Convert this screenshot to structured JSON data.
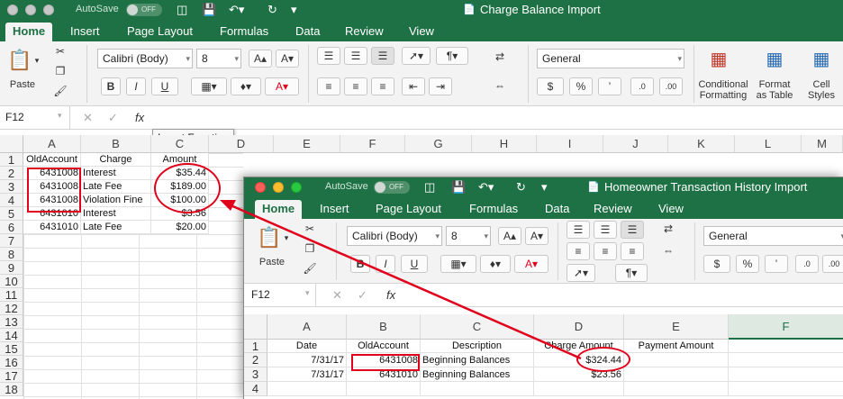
{
  "colors": {
    "excel_green": "#1e7145",
    "annotation_red": "#e0001b"
  },
  "window1": {
    "title": "Charge Balance Import",
    "autosave_label": "AutoSave",
    "autosave_state": "OFF",
    "tabs": [
      "Home",
      "Insert",
      "Page Layout",
      "Formulas",
      "Data",
      "Review",
      "View"
    ],
    "ribbon": {
      "paste_label": "Paste",
      "font_name": "Calibri (Body)",
      "font_size": "8",
      "grow_font": "A▴",
      "shrink_font": "A▾",
      "bold": "B",
      "italic": "I",
      "underline": "U",
      "number_format": "General",
      "currency": "$",
      "percent": "%",
      "comma": "’",
      "conditional_formatting": "Conditional Formatting",
      "format_as_table": "Format as Table",
      "cell_styles": "Cell Styles"
    },
    "formula_bar": {
      "name_box": "F12",
      "fx": "fx",
      "tooltip": "Insert Function"
    },
    "columns": [
      "A",
      "B",
      "C",
      "D",
      "E",
      "F",
      "G",
      "H",
      "I",
      "J",
      "K",
      "L",
      "M"
    ],
    "rows": [
      "1",
      "2",
      "3",
      "4",
      "5",
      "6",
      "7",
      "8",
      "9",
      "10",
      "11",
      "12",
      "13",
      "14",
      "15",
      "16",
      "17",
      "18"
    ],
    "data": [
      [
        "OldAccount",
        "Charge",
        "Amount"
      ],
      [
        "6431008",
        "Interest",
        "$35.44"
      ],
      [
        "6431008",
        "Late Fee",
        "$189.00"
      ],
      [
        "6431008",
        "Violation Fine",
        "$100.00"
      ],
      [
        "6431010",
        "Interest",
        "$3.56"
      ],
      [
        "6431010",
        "Late Fee",
        "$20.00"
      ]
    ]
  },
  "window2": {
    "title": "Homeowner Transaction History Import",
    "autosave_label": "AutoSave",
    "autosave_state": "OFF",
    "tabs": [
      "Home",
      "Insert",
      "Page Layout",
      "Formulas",
      "Data",
      "Review",
      "View"
    ],
    "ribbon": {
      "paste_label": "Paste",
      "font_name": "Calibri (Body)",
      "font_size": "8",
      "grow_font": "A▴",
      "shrink_font": "A▾",
      "bold": "B",
      "italic": "I",
      "underline": "U",
      "number_format": "General",
      "currency": "$",
      "percent": "%",
      "comma": "’"
    },
    "formula_bar": {
      "name_box": "F12",
      "fx": "fx"
    },
    "columns": [
      "A",
      "B",
      "C",
      "D",
      "E",
      "F"
    ],
    "rows": [
      "1",
      "2",
      "3",
      "4"
    ],
    "data": [
      [
        "Date",
        "OldAccount",
        "Description",
        "Charge Amount",
        "Payment Amount"
      ],
      [
        "7/31/17",
        "6431008",
        "Beginning Balances",
        "$324.44",
        ""
      ],
      [
        "7/31/17",
        "6431010",
        "Beginning Balances",
        "$23.56",
        ""
      ]
    ]
  }
}
